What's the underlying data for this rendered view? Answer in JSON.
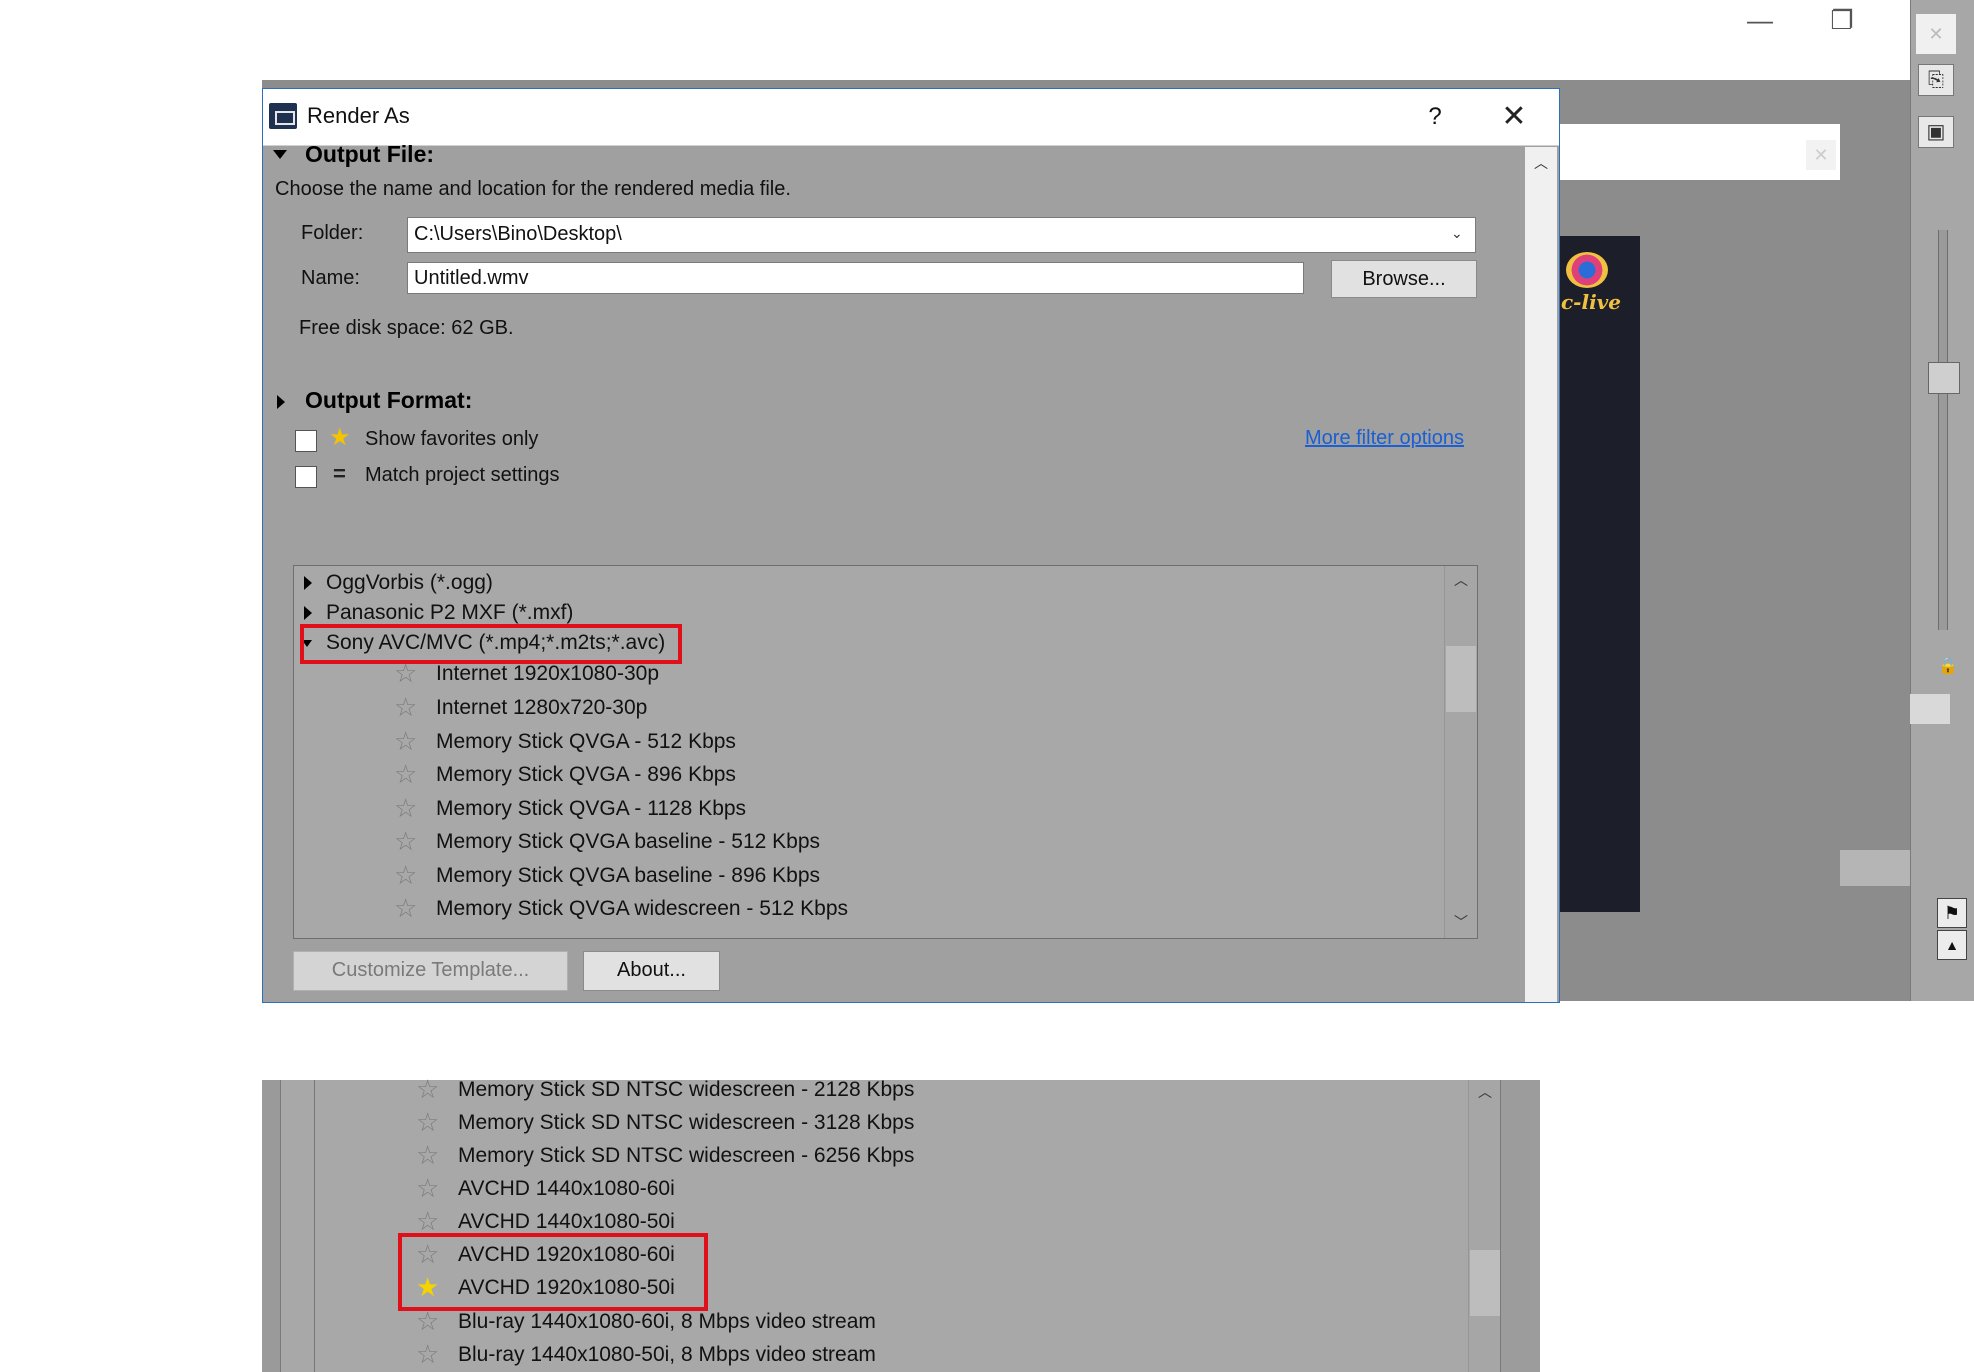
{
  "background_app": {
    "window_controls": {
      "minimize": "—",
      "restore": "❐"
    },
    "logo_text": "c-live",
    "close_glyph": "✕"
  },
  "dialog": {
    "title": "Render As",
    "help_label": "?",
    "close_label": "✕",
    "output_file": {
      "heading": "Output File:",
      "description": "Choose the name and location for the rendered media file.",
      "folder_label": "Folder:",
      "folder_value": "C:\\Users\\Bino\\Desktop\\",
      "name_label": "Name:",
      "name_value": "Untitled.wmv",
      "browse_label": "Browse...",
      "free_space": "Free disk space: 62 GB."
    },
    "output_format": {
      "heading": "Output Format:",
      "show_favorites_label": "Show favorites only",
      "match_project_label": "Match project settings",
      "more_filter_label": "More filter options",
      "formats": [
        {
          "label": "OggVorbis (*.ogg)",
          "expanded": false
        },
        {
          "label": "Panasonic P2 MXF (*.mxf)",
          "expanded": false
        },
        {
          "label": "Sony AVC/MVC (*.mp4;*.m2ts;*.avc)",
          "expanded": true,
          "highlighted": true
        }
      ],
      "templates": [
        {
          "label": "Internet 1920x1080-30p",
          "favorite": false
        },
        {
          "label": "Internet 1280x720-30p",
          "favorite": false
        },
        {
          "label": "Memory Stick QVGA - 512 Kbps",
          "favorite": false
        },
        {
          "label": "Memory Stick QVGA - 896 Kbps",
          "favorite": false
        },
        {
          "label": "Memory Stick QVGA - 1128 Kbps",
          "favorite": false
        },
        {
          "label": "Memory Stick QVGA baseline - 512 Kbps",
          "favorite": false
        },
        {
          "label": "Memory Stick QVGA baseline - 896 Kbps",
          "favorite": false
        },
        {
          "label": "Memory Stick QVGA widescreen - 512 Kbps",
          "favorite": false
        }
      ],
      "customize_label": "Customize Template...",
      "about_label": "About..."
    }
  },
  "zoom_crop": {
    "templates": [
      {
        "label": "Memory Stick SD NTSC widescreen - 2128 Kbps",
        "favorite": false
      },
      {
        "label": "Memory Stick SD NTSC widescreen - 3128 Kbps",
        "favorite": false
      },
      {
        "label": "Memory Stick SD NTSC widescreen - 6256 Kbps",
        "favorite": false
      },
      {
        "label": "AVCHD 1440x1080-60i",
        "favorite": false
      },
      {
        "label": "AVCHD 1440x1080-50i",
        "favorite": false
      },
      {
        "label": "AVCHD 1920x1080-60i",
        "favorite": false,
        "highlighted": true
      },
      {
        "label": "AVCHD 1920x1080-50i",
        "favorite": true,
        "highlighted": true
      },
      {
        "label": "Blu-ray 1440x1080-60i, 8 Mbps video stream",
        "favorite": false
      },
      {
        "label": "Blu-ray 1440x1080-50i, 8 Mbps video stream",
        "favorite": false
      }
    ]
  },
  "colors": {
    "highlight": "#e0101a",
    "favorite_star": "#f4d400",
    "link": "#1a5fd3",
    "dialog_bg": "#a0a0a0"
  }
}
